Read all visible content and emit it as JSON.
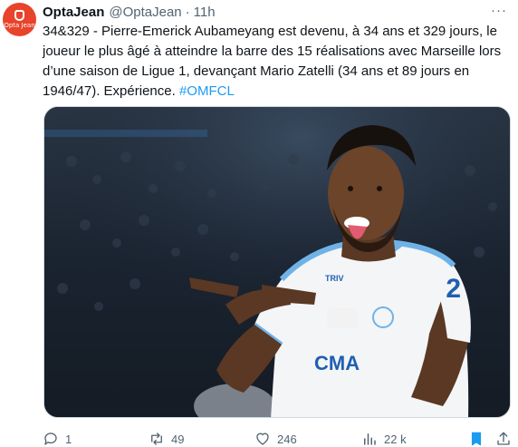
{
  "account": {
    "name": "OptaJean",
    "handle": "@OptaJean",
    "separator": "·",
    "time": "11h",
    "avatar_text": "Opta Jean"
  },
  "tweet": {
    "text": "34&329 - Pierre-Emerick Aubameyang est devenu, à 34 ans et 329 jours, le joueur le plus âgé à atteindre la barre des 15 réalisations avec Marseille lors d’une saison de Ligue 1, devançant Mario Zatelli (34 ans et 89 jours en 1946/47). Expérience.",
    "hashtag": "#OMFCL"
  },
  "media": {
    "jersey_sponsor": "CMA",
    "chest_text": "TRIV"
  },
  "actions": {
    "replies": "1",
    "reposts": "49",
    "likes": "246",
    "views": "22 k"
  },
  "colors": {
    "accent": "#1d9bf0",
    "muted": "#536471",
    "bookmark": "#1d9bf0",
    "avatar_bg": "#e8432b"
  },
  "icons": {
    "more": "more-dots-icon",
    "reply": "reply-icon",
    "repost": "repost-icon",
    "like": "heart-icon",
    "views": "views-bar-icon",
    "bookmark": "bookmark-icon",
    "share": "share-icon"
  }
}
